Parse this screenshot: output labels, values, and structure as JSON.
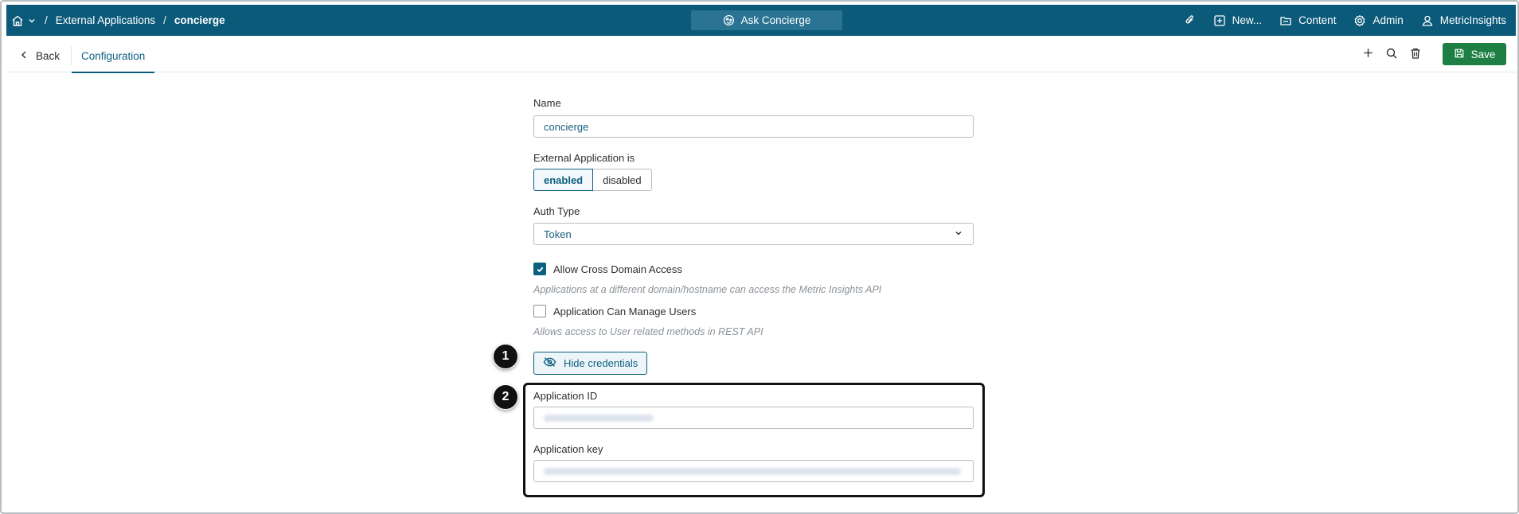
{
  "topbar": {
    "breadcrumbs": [
      "External Applications",
      "concierge"
    ],
    "ask_label": "Ask Concierge",
    "new_label": "New...",
    "content_label": "Content",
    "admin_label": "Admin",
    "user_label": "MetricInsights",
    "bg_color": "#0b5a7a"
  },
  "subheader": {
    "back_label": "Back",
    "tab_label": "Configuration",
    "save_label": "Save",
    "accent_color": "#0d5f80",
    "save_color": "#1d7f43"
  },
  "form": {
    "name_label": "Name",
    "name_value": "concierge",
    "status_label": "External Application is",
    "status_options": [
      "enabled",
      "disabled"
    ],
    "status_selected": "enabled",
    "auth_label": "Auth Type",
    "auth_value": "Token",
    "cross_domain_label": "Allow Cross Domain Access",
    "cross_domain_checked": true,
    "cross_domain_hint": "Applications at a different domain/hostname can access the Metric Insights API",
    "manage_users_label": "Application Can Manage Users",
    "manage_users_checked": false,
    "manage_users_hint": "Allows access to User related methods in REST API",
    "hide_credentials_label": "Hide credentials",
    "app_id_label": "Application ID",
    "app_key_label": "Application key"
  },
  "callouts": [
    "1",
    "2"
  ]
}
